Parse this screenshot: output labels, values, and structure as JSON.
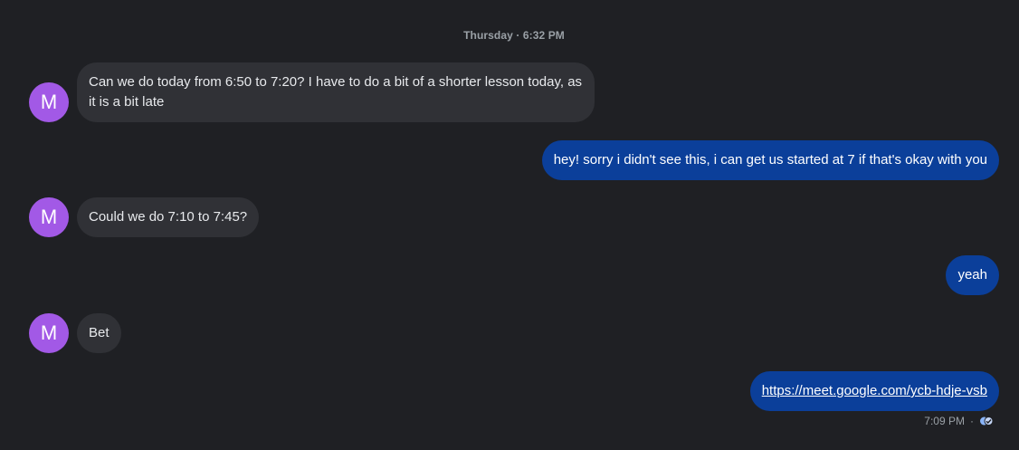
{
  "header": {
    "timestamp": "Thursday · 6:32 PM"
  },
  "contact": {
    "initial": "M"
  },
  "messages": [
    {
      "direction": "in",
      "text": "Can we do today from 6:50 to 7:20? I have to do a bit of a shorter lesson today, as it is a bit late"
    },
    {
      "direction": "out",
      "text": "hey! sorry i didn't see this, i can get us started at 7 if that's okay with you"
    },
    {
      "direction": "in",
      "text": "Could we do 7:10 to 7:45?"
    },
    {
      "direction": "out",
      "text": "yeah"
    },
    {
      "direction": "in",
      "text": "Bet"
    },
    {
      "direction": "out",
      "text": "https://meet.google.com/ycb-hdje-vsb",
      "is_link": true
    }
  ],
  "last_message_meta": {
    "time": "7:09 PM",
    "separator": "·",
    "status_icon": "read-receipt-icon"
  },
  "colors": {
    "background": "#1f2024",
    "incoming_bubble": "#303136",
    "outgoing_bubble": "#0b3f9a",
    "avatar": "#a259e6"
  }
}
